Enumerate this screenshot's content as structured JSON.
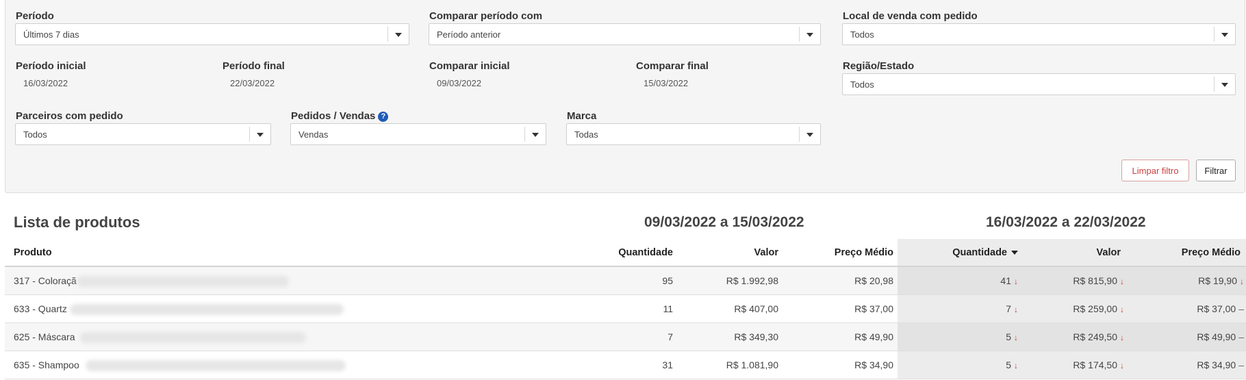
{
  "filters": {
    "periodo": {
      "label": "Período",
      "value": "Últimos 7 dias"
    },
    "comparar_periodo": {
      "label": "Comparar período com",
      "value": "Período anterior"
    },
    "local_venda": {
      "label": "Local de venda com pedido",
      "value": "Todos"
    },
    "periodo_inicial": {
      "label": "Período inicial",
      "value": "16/03/2022"
    },
    "periodo_final": {
      "label": "Período final",
      "value": "22/03/2022"
    },
    "comparar_inicial": {
      "label": "Comparar inicial",
      "value": "09/03/2022"
    },
    "comparar_final": {
      "label": "Comparar final",
      "value": "15/03/2022"
    },
    "regiao": {
      "label": "Região/Estado",
      "value": "Todos"
    },
    "parceiros": {
      "label": "Parceiros com pedido",
      "value": "Todos"
    },
    "pedidos_vendas": {
      "label": "Pedidos / Vendas",
      "value": "Vendas",
      "help": "?"
    },
    "marca": {
      "label": "Marca",
      "value": "Todas"
    },
    "clear_label": "Limpar filtro",
    "filter_label": "Filtrar"
  },
  "list": {
    "title": "Lista de produtos",
    "period_a": "09/03/2022 a 15/03/2022",
    "period_b": "16/03/2022 a 22/03/2022",
    "columns": {
      "produto": "Produto",
      "qtd_a": "Quantidade",
      "valor_a": "Valor",
      "preco_a": "Preço Médio",
      "qtd_b": "Quantidade",
      "valor_b": "Valor",
      "preco_b": "Preço Médio"
    },
    "rows": [
      {
        "produto": "317 - Coloraçã",
        "qtd_a": "95",
        "valor_a": "R$ 1.992,98",
        "preco_a": "R$ 20,98",
        "qtd_b": "41",
        "valor_b": "R$ 815,90",
        "preco_b": "R$ 19,90"
      },
      {
        "produto": "633 - Quartz",
        "qtd_a": "11",
        "valor_a": "R$ 407,00",
        "preco_a": "R$ 37,00",
        "qtd_b": "7",
        "valor_b": "R$ 259,00",
        "preco_b": "R$ 37,00"
      },
      {
        "produto": "625 - Máscara",
        "qtd_a": "7",
        "valor_a": "R$ 349,30",
        "preco_a": "R$ 49,90",
        "qtd_b": "5",
        "valor_b": "R$ 249,50",
        "preco_b": "R$ 49,90"
      },
      {
        "produto": "635 - Shampoo",
        "qtd_a": "31",
        "valor_a": "R$ 1.081,90",
        "preco_a": "R$ 34,90",
        "qtd_b": "5",
        "valor_b": "R$ 174,50",
        "preco_b": "R$ 34,90"
      }
    ],
    "trend": {
      "down": "↓",
      "same": "–"
    },
    "colors": {
      "down": "#d9302c",
      "highlight_bg": "#ececec"
    }
  }
}
